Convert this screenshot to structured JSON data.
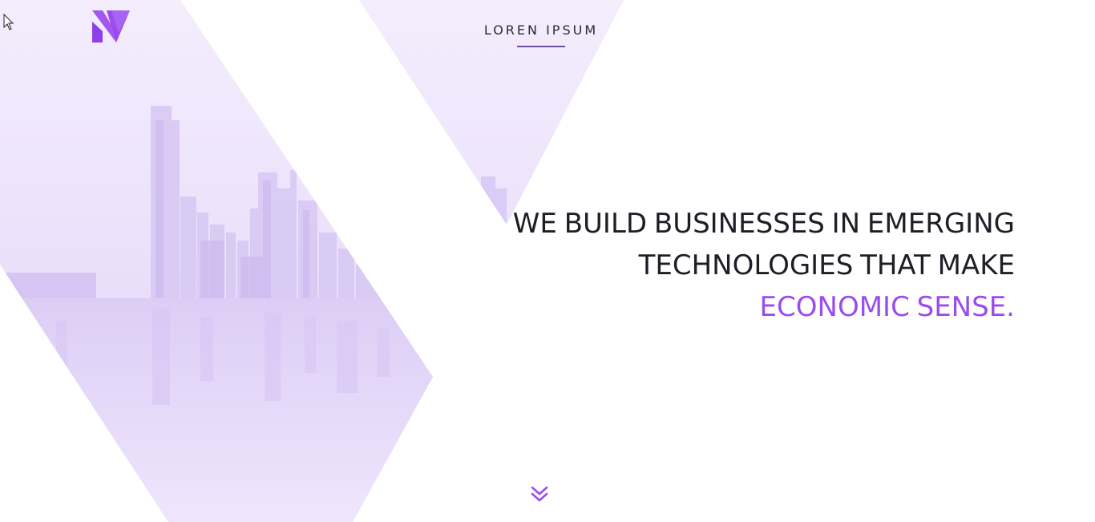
{
  "header": {
    "brand_icon": "n-logo-icon",
    "nav_title": "LOREN IPSUM"
  },
  "hero": {
    "headline_line1": "WE BUILD BUSINESSES IN EMERGING",
    "headline_line2": "TECHNOLOGIES THAT MAKE",
    "headline_accent": "ECONOMIC SENSE.",
    "background_image": "city-skyline-image",
    "scroll_icon": "double-chevron-down-icon"
  },
  "colors": {
    "accent": "#9A4CF0",
    "text": "#1F1D26",
    "tint": "#E9DEFA"
  }
}
